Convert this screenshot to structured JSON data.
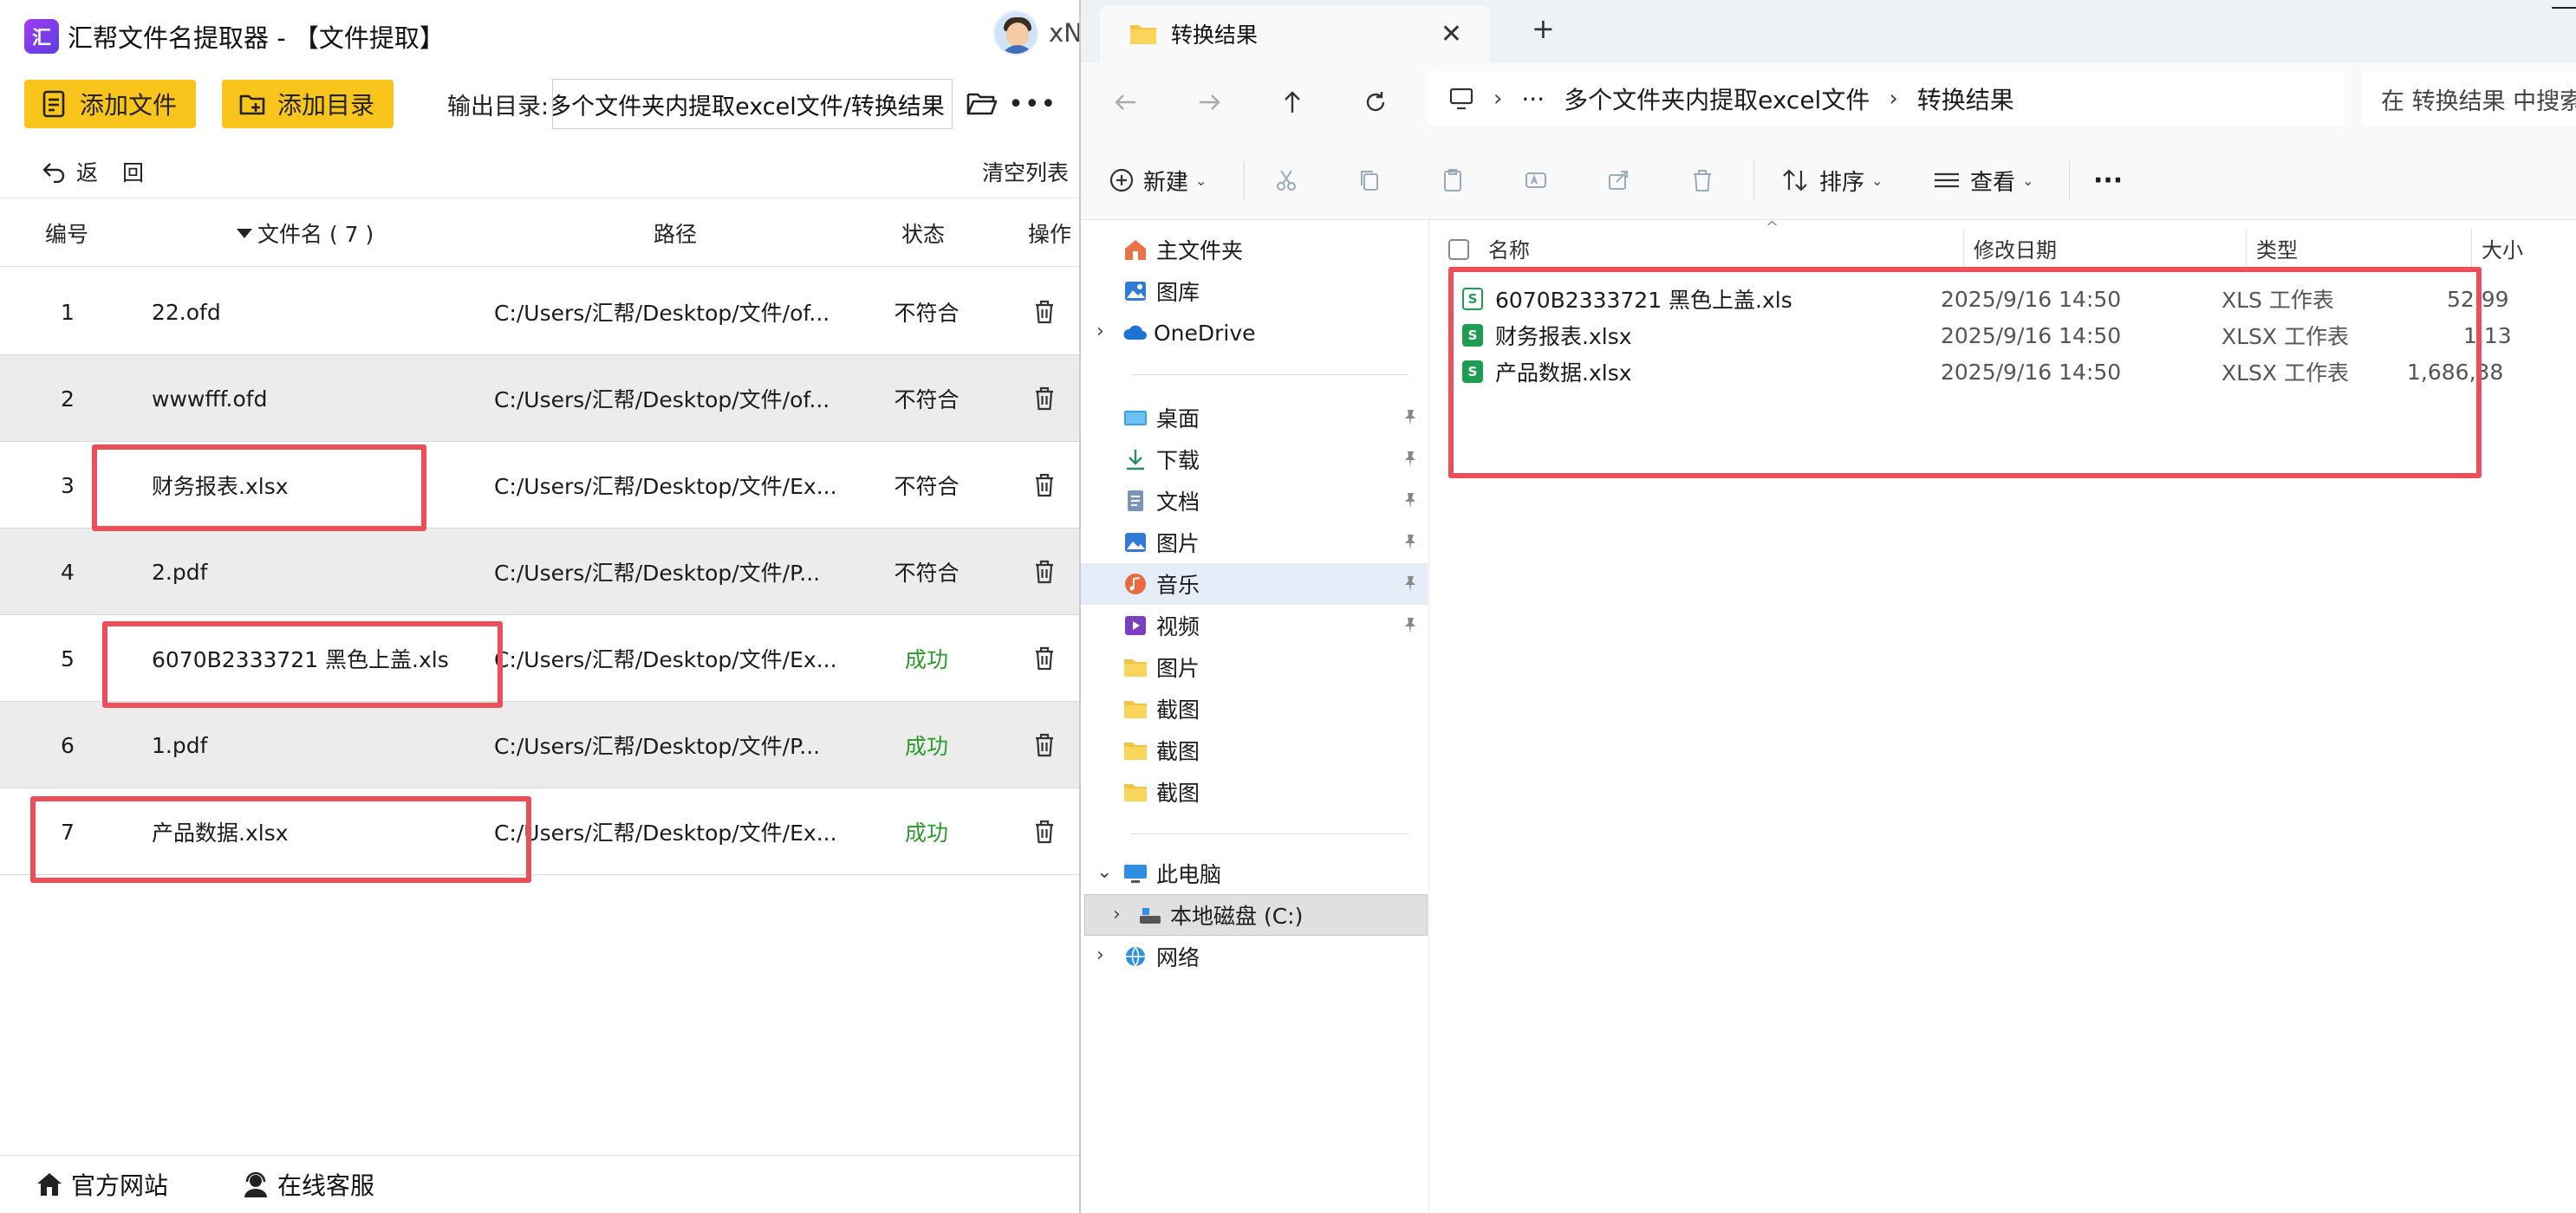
{
  "app": {
    "title": "汇帮文件名提取器 - 【文件提取】",
    "logo_text": "汇",
    "user_name": "xN",
    "toolbar": {
      "add_file_label": "添加文件",
      "add_dir_label": "添加目录",
      "output_label": "输出目录:",
      "output_path": "多个文件夹内提取excel文件/转换结果",
      "more_label": "•••"
    },
    "back_label": "返回",
    "clear_label": "清空列表",
    "columns": {
      "num": "编号",
      "name": "文件名 ( 7 )",
      "path": "路径",
      "status": "状态",
      "op": "操作"
    },
    "rows": [
      {
        "num": "1",
        "name": "22.ofd",
        "path": "C:/Users/汇帮/Desktop/文件/of...",
        "status": "不符合"
      },
      {
        "num": "2",
        "name": "wwwfff.ofd",
        "path": "C:/Users/汇帮/Desktop/文件/of...",
        "status": "不符合"
      },
      {
        "num": "3",
        "name": "财务报表.xlsx",
        "path": "C:/Users/汇帮/Desktop/文件/Ex...",
        "status": "不符合"
      },
      {
        "num": "4",
        "name": "2.pdf",
        "path": "C:/Users/汇帮/Desktop/文件/P...",
        "status": "不符合"
      },
      {
        "num": "5",
        "name": "6070B2333721 黑色上盖.xls",
        "path": "C:/Users/汇帮/Desktop/文件/Ex...",
        "status": "成功"
      },
      {
        "num": "6",
        "name": "1.pdf",
        "path": "C:/Users/汇帮/Desktop/文件/P...",
        "status": "成功"
      },
      {
        "num": "7",
        "name": "产品数据.xlsx",
        "path": "C:/Users/汇帮/Desktop/文件/Ex...",
        "status": "成功"
      }
    ],
    "footer": {
      "website_label": "官方网站",
      "service_label": "在线客服"
    },
    "colors": {
      "accent_yellow": "#f9c41b",
      "success_green": "#2a9a2a",
      "highlight_red": "#ee4e57"
    }
  },
  "explorer": {
    "tab_title": "转换结果",
    "tab_close": "✕",
    "tab_add": "+",
    "address": {
      "ellipsis": "···",
      "folder": "多个文件夹内提取excel文件",
      "current": "转换结果",
      "separator": "›"
    },
    "search_placeholder": "在 转换结果 中搜索",
    "commands": {
      "new_label": "新建",
      "sort_label": "排序",
      "view_label": "查看",
      "more_label": "···"
    },
    "sidebar": {
      "home": "主文件夹",
      "gallery": "图库",
      "onedrive": "OneDrive",
      "desktop": "桌面",
      "downloads": "下载",
      "documents": "文档",
      "pictures": "图片",
      "music": "音乐",
      "videos": "视频",
      "folder_pictures": "图片",
      "folder_shot1": "截图",
      "folder_shot2": "截图",
      "folder_shot3": "截图",
      "this_pc": "此电脑",
      "local_disk": "本地磁盘 (C:)",
      "network": "网络"
    },
    "columns": {
      "name": "名称",
      "date": "修改日期",
      "type": "类型",
      "size": "大小"
    },
    "files": [
      {
        "icon": "S",
        "name": "6070B2333721 黑色上盖.xls",
        "date": "2025/9/16 14:50",
        "type": "XLS 工作表",
        "size": "52,99"
      },
      {
        "icon": "S",
        "name": "财务报表.xlsx",
        "date": "2025/9/16 14:50",
        "type": "XLSX 工作表",
        "size": "1,13"
      },
      {
        "icon": "S",
        "name": "产品数据.xlsx",
        "date": "2025/9/16 14:50",
        "type": "XLSX 工作表",
        "size": "1,686,38"
      }
    ]
  }
}
